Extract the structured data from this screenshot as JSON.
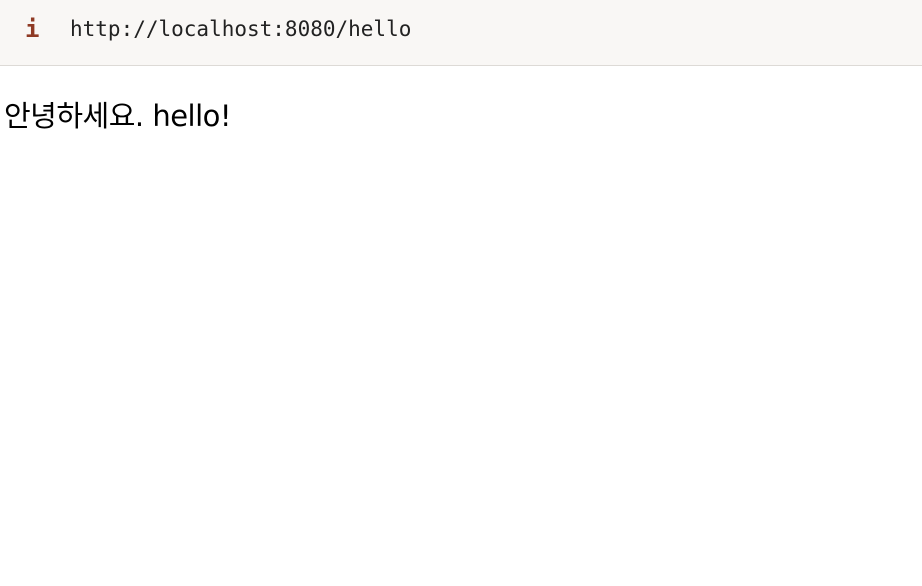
{
  "address_bar": {
    "icon": "info-icon",
    "icon_glyph": "i",
    "icon_color": "#8f3a24",
    "url": "http://localhost:8080/hello"
  },
  "page": {
    "text": "안녕하세요. hello!"
  }
}
